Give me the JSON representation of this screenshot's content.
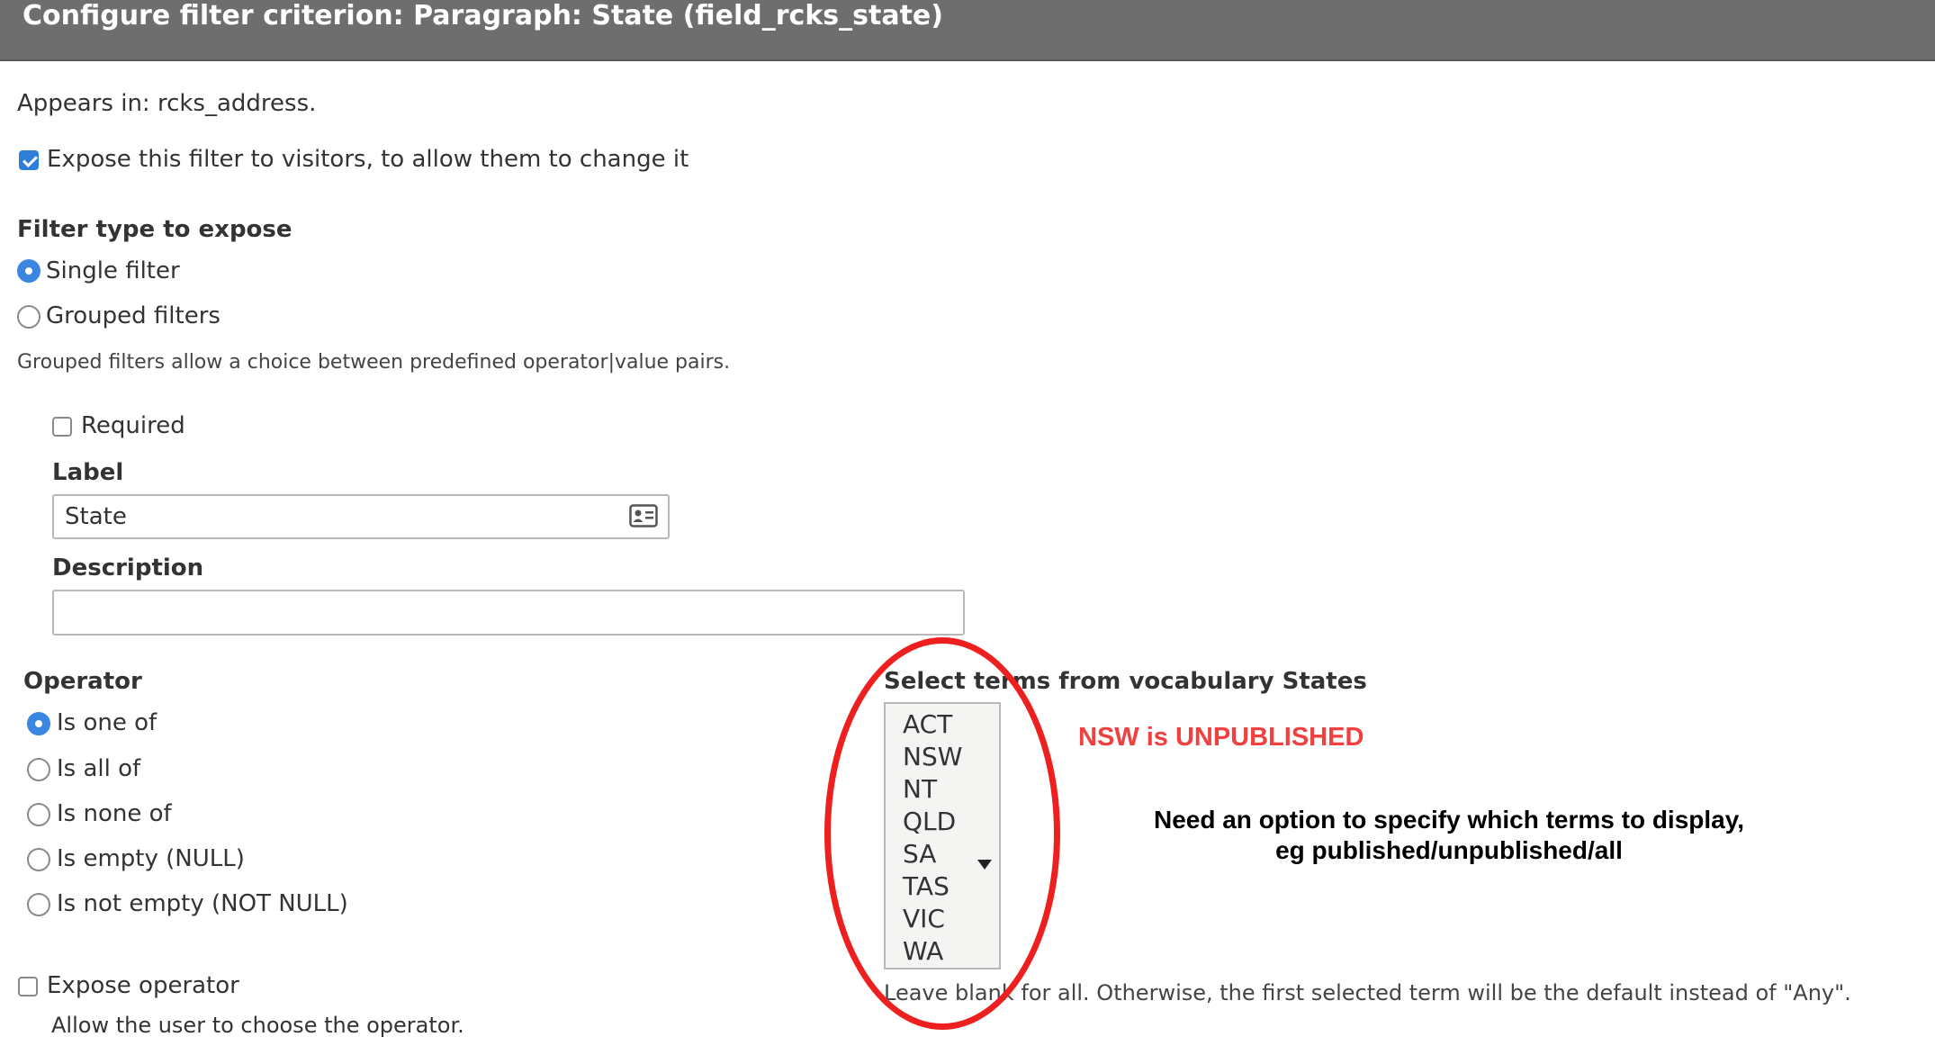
{
  "dialog": {
    "title": "Configure filter criterion: Paragraph: State (field_rcks_state)"
  },
  "appears_in": "Appears in: rcks_address.",
  "expose_filter": {
    "label": "Expose this filter to visitors, to allow them to change it",
    "checked": true
  },
  "filter_type": {
    "heading": "Filter type to expose",
    "options": [
      {
        "label": "Single filter",
        "selected": true
      },
      {
        "label": "Grouped filters",
        "selected": false
      }
    ],
    "description": "Grouped filters allow a choice between predefined operator|value pairs."
  },
  "required": {
    "label": "Required",
    "checked": false
  },
  "label_field": {
    "heading": "Label",
    "value": "State",
    "icon": "contact-card-icon"
  },
  "description_field": {
    "heading": "Description",
    "value": ""
  },
  "operator": {
    "heading": "Operator",
    "options": [
      {
        "label": "Is one of",
        "selected": true
      },
      {
        "label": "Is all of",
        "selected": false
      },
      {
        "label": "Is none of",
        "selected": false
      },
      {
        "label": "Is empty (NULL)",
        "selected": false
      },
      {
        "label": "Is not empty (NOT NULL)",
        "selected": false
      }
    ]
  },
  "expose_operator": {
    "label": "Expose operator",
    "checked": false,
    "description": "Allow the user to choose the operator."
  },
  "terms": {
    "heading": "Select terms from vocabulary States",
    "options": [
      "ACT",
      "NSW",
      "NT",
      "QLD",
      "SA",
      "TAS",
      "VIC",
      "WA"
    ],
    "help": "Leave blank for all. Otherwise, the first selected term will be the default instead of \"Any\"."
  },
  "annotations": {
    "red_note": "NSW is UNPUBLISHED",
    "black_note_line1": "Need an option to specify which terms to display,",
    "black_note_line2": "eg published/unpublished/all",
    "highlight_color": "#ee1f1f",
    "red_note_color": "#f04040"
  },
  "colors": {
    "titlebar": "#6e6e6e",
    "accent": "#3b86e0"
  }
}
